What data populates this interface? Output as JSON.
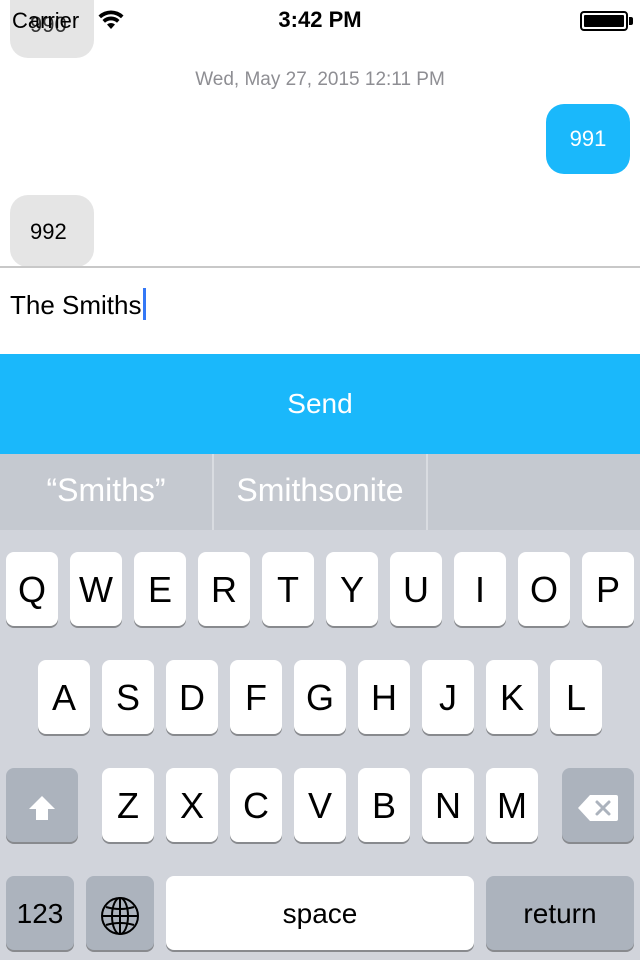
{
  "status_bar": {
    "carrier": "Carrier",
    "time": "3:42 PM"
  },
  "messages": [
    {
      "text": "990",
      "side": "left"
    },
    {
      "text": "991",
      "side": "right"
    },
    {
      "text": "992",
      "side": "left"
    }
  ],
  "timestamp": "Wed, May 27, 2015 12:11 PM",
  "input": {
    "value": "The Smiths"
  },
  "send_button": {
    "label": "Send"
  },
  "predictive_bar": {
    "suggestions": [
      "“Smiths”",
      "Smithsonite",
      ""
    ]
  },
  "keyboard": {
    "row1": [
      "Q",
      "W",
      "E",
      "R",
      "T",
      "Y",
      "U",
      "I",
      "O",
      "P"
    ],
    "row2": [
      "A",
      "S",
      "D",
      "F",
      "G",
      "H",
      "J",
      "K",
      "L"
    ],
    "row3": [
      "Z",
      "X",
      "C",
      "V",
      "B",
      "N",
      "M"
    ],
    "numbers_label": "123",
    "space_label": "space",
    "return_label": "return",
    "shift_icon": "shift-icon",
    "delete_icon": "delete-icon",
    "globe_icon": "globe-icon"
  },
  "colors": {
    "accent": "#1ab8fb",
    "incoming_bubble": "#e5e5e5",
    "keyboard_bg": "#d1d4db"
  }
}
